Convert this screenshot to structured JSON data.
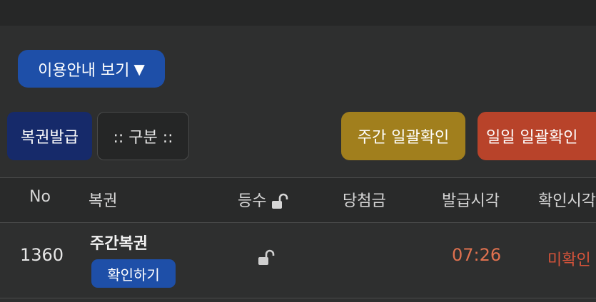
{
  "guide_button": {
    "label": "이용안내 보기",
    "arrow": "▼"
  },
  "filters": {
    "issue": "복권발급",
    "category": ":: 구분 ::",
    "weekly_confirm": "주간 일괄확인",
    "daily_confirm": "일일 일괄확인"
  },
  "table": {
    "headers": {
      "no": "No",
      "lottery": "복권",
      "rank": "등수",
      "prize": "당첨금",
      "issued_time": "발급시각",
      "confirm_time": "확인시각"
    },
    "rows": [
      {
        "no": "1360",
        "lottery": "주간복권",
        "confirm_label": "확인하기",
        "rank_icon": "unlock-icon",
        "prize": "",
        "issued_time": "07:26",
        "confirm_status": "미확인"
      }
    ]
  },
  "colors": {
    "background": "#2e2f2f",
    "blue": "#1e4fa8",
    "navy": "#162a6a",
    "gold": "#a17f1d",
    "red": "#b8432a",
    "time_orange": "#e0714f"
  }
}
